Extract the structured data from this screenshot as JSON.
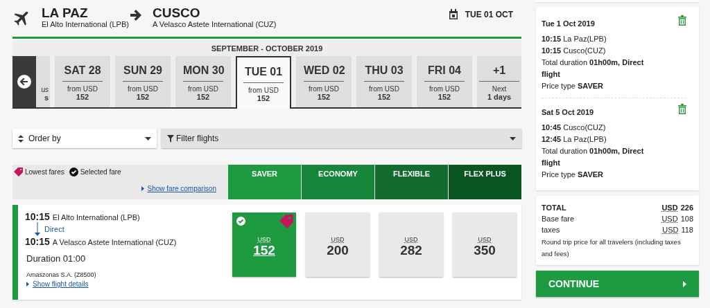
{
  "header": {
    "origin": {
      "city": "LA PAZ",
      "airport": "El Alto International (LPB)"
    },
    "destination": {
      "city": "CUSCO",
      "airport": "A Velasco Astete International (CUZ)"
    },
    "date": "TUE 01 OCT"
  },
  "calendar": {
    "month": "SEPTEMBER - OCTOBER 2019",
    "days": [
      {
        "kind": "partial",
        "caption": "us",
        "price": "s",
        "selected": false
      },
      {
        "kind": "day",
        "label": "SAT 28",
        "caption": "from USD",
        "price": "152",
        "selected": false
      },
      {
        "kind": "day",
        "label": "SUN 29",
        "caption": "from USD",
        "price": "152",
        "selected": false
      },
      {
        "kind": "day",
        "label": "MON 30",
        "caption": "from USD",
        "price": "152",
        "selected": false
      },
      {
        "kind": "day",
        "label": "TUE 01",
        "caption": "from USD",
        "price": "152",
        "selected": true
      },
      {
        "kind": "day",
        "label": "WED 02",
        "caption": "from USD",
        "price": "152",
        "selected": false
      },
      {
        "kind": "day",
        "label": "THU 03",
        "caption": "from USD",
        "price": "152",
        "selected": false
      },
      {
        "kind": "day",
        "label": "FRI 04",
        "caption": "from USD",
        "price": "152",
        "selected": false
      },
      {
        "kind": "next",
        "label": "+1",
        "caption": "Next",
        "price": "1 days",
        "selected": false
      }
    ]
  },
  "order_by": {
    "label": "Order by"
  },
  "filter": {
    "label": "Filter flights"
  },
  "legend": {
    "lowest": "Lowest fares",
    "selected": "Selected fare",
    "link": "Show fare comparison"
  },
  "fare_classes": [
    {
      "name": "SAVER",
      "color": "#1e9a40"
    },
    {
      "name": "ECONOMY",
      "color": "#17863a"
    },
    {
      "name": "FLEXIBLE",
      "color": "#116c2e"
    },
    {
      "name": "FLEX PLUS",
      "color": "#0b5523"
    }
  ],
  "flight": {
    "departure_time": "10:15",
    "departure_airport": "El Alto International (LPB)",
    "stops": "Direct",
    "arrival_time": "10:15",
    "arrival_airport": "A Velasco Astete International (CUZ)",
    "duration": "Duration 01:00",
    "carrier": "Amaszonas S.A. (Z8500)",
    "details_link": "Show flight details",
    "fares": [
      {
        "currency": "USD",
        "price": "152",
        "selected": true,
        "lowest": true
      },
      {
        "currency": "USD",
        "price": "200",
        "selected": false,
        "lowest": false
      },
      {
        "currency": "USD",
        "price": "282",
        "selected": false,
        "lowest": false
      },
      {
        "currency": "USD",
        "price": "350",
        "selected": false,
        "lowest": false
      }
    ]
  },
  "summary": {
    "legs": [
      {
        "date": "Tue 1 Oct 2019",
        "lines": [
          "**10:15** La Paz(LPB)",
          "**10:15** Cusco(CUZ)",
          "Total duration **01h00m, Direct flight**",
          "Price type **SAVER**"
        ]
      },
      {
        "date": "Sat 5 Oct 2019",
        "lines": [
          "**10:45** Cusco(CUZ)",
          "**12:45** La Paz(LPB)",
          "Total duration **01h00m, Direct flight**",
          "Price type **SAVER**"
        ]
      }
    ],
    "totals": [
      {
        "label": "TOTAL",
        "currency": "USD",
        "amount": "226",
        "bold": true
      },
      {
        "label": "Base fare",
        "currency": "USD",
        "amount": "108",
        "bold": false
      },
      {
        "label": "taxes",
        "currency": "USD",
        "amount": "118",
        "bold": false
      }
    ],
    "note": "Round trip price for all travelers (including taxes and fees)",
    "continue": "CONTINUE"
  }
}
